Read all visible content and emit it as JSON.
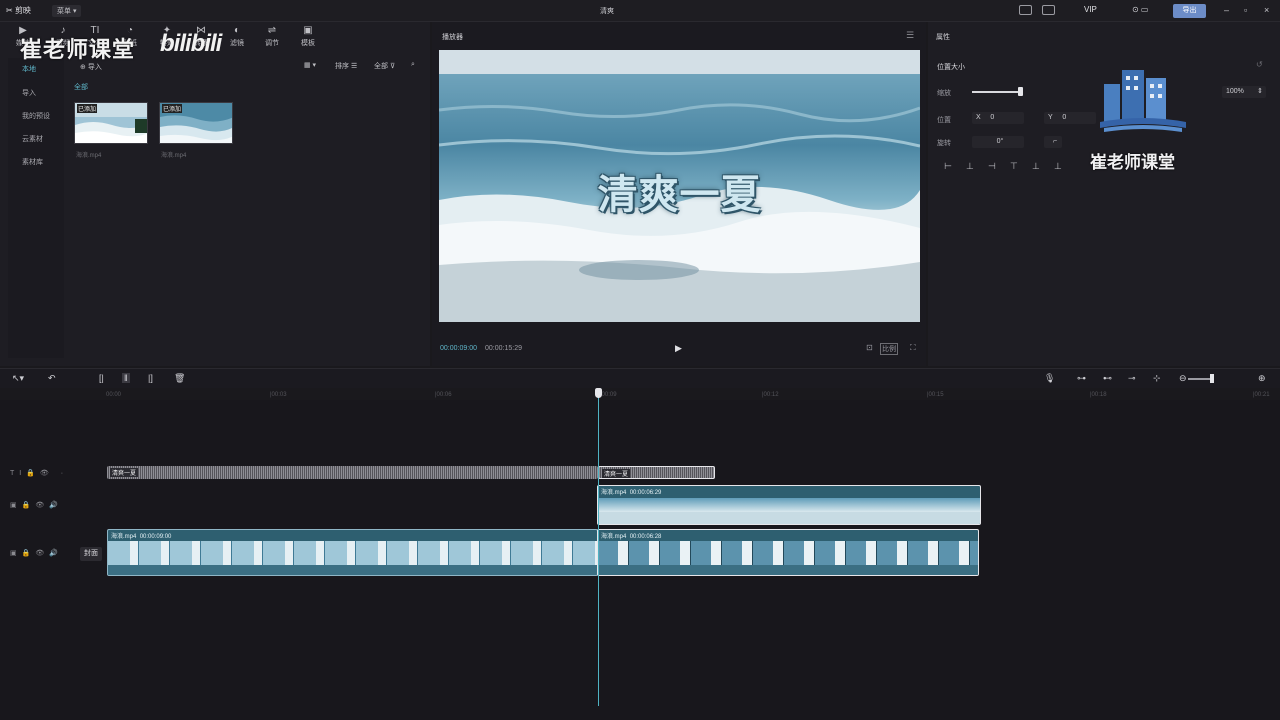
{
  "app": {
    "logo_label": "剪映",
    "menu_label": "菜单",
    "project_title": "清爽",
    "vip_label": "VIP",
    "export_label": "导出",
    "accent": "#5fb6c9",
    "export_color": "#6c8cc7"
  },
  "media": {
    "tools": [
      {
        "label": "媒体",
        "icon": "media-icon"
      },
      {
        "label": "音频",
        "icon": "audio-icon"
      },
      {
        "label": "文本",
        "icon": "text-icon"
      },
      {
        "label": "贴纸",
        "icon": "sticker-icon"
      },
      {
        "label": "特效",
        "icon": "effects-icon"
      },
      {
        "label": "转场",
        "icon": "transition-icon"
      },
      {
        "label": "滤镜",
        "icon": "filter-icon"
      },
      {
        "label": "调节",
        "icon": "adjust-icon"
      },
      {
        "label": "模板",
        "icon": "template-icon"
      }
    ],
    "sidebar": [
      "本地",
      "导入",
      "我的预设",
      "云素材",
      "素材库"
    ],
    "import_label": "导入",
    "all_label": "全部",
    "sort_label": "排序",
    "filter_label": "全部",
    "files": [
      {
        "name": "海浪.mp4",
        "badge": "已添加"
      },
      {
        "name": "海浪.mp4",
        "badge": "已添加"
      }
    ]
  },
  "watermark": {
    "text": "崔老师课堂",
    "bili": "bilibili",
    "caption": "崔老师课堂"
  },
  "player": {
    "title": "播放器",
    "video_title": "清爽一夏",
    "time_current": "00:00:09:00",
    "time_total": "00:00:15:29",
    "ratio_label": "比例"
  },
  "properties": {
    "title": "属性",
    "section": "位置大小",
    "scale_label": "缩放",
    "scale_value": "100%",
    "scale_fraction": 1.0,
    "position_label": "位置",
    "pos_x_label": "X",
    "pos_x": "0",
    "pos_y_label": "Y",
    "pos_y": "0",
    "rotate_label": "旋转",
    "rotate_value": "0°"
  },
  "timeline": {
    "ticks": [
      "00:00",
      "|00:03",
      "|00:06",
      "|00:09",
      "|00:12",
      "|00:15",
      "|00:18",
      "|00:21"
    ],
    "cover_label": "封面",
    "text_clips": [
      {
        "label": "清爽一夏"
      },
      {
        "label": "清爽一夏"
      }
    ],
    "overlay_clip": {
      "name": "海浪.mp4",
      "duration": "00:00:06:29"
    },
    "main_clips": [
      {
        "name": "海浪.mp4",
        "duration": "00:00:09:00"
      },
      {
        "name": "海浪.mp4",
        "duration": "00:00:06:28"
      }
    ]
  }
}
